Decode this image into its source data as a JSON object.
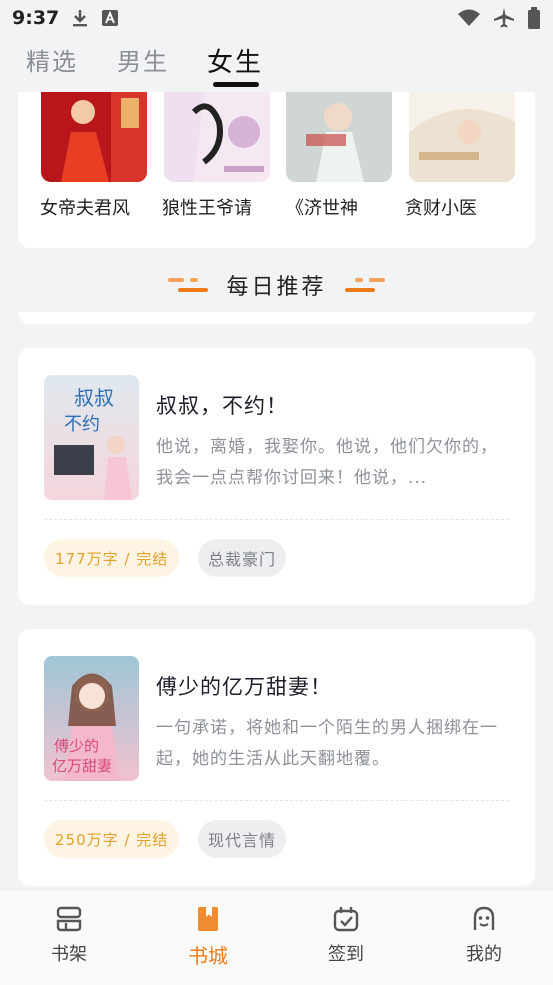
{
  "status": {
    "time": "9:37"
  },
  "tabs": [
    {
      "label": "精选",
      "active": false
    },
    {
      "label": "男生",
      "active": false
    },
    {
      "label": "女生",
      "active": true
    }
  ],
  "featured": [
    {
      "title": "女帝夫君风",
      "cover_colors": [
        "#b8161a",
        "#e24b2e"
      ]
    },
    {
      "title": "狼性王爷请",
      "cover_colors": [
        "#f4e9f3",
        "#d7b3d6"
      ]
    },
    {
      "title": "《济世神",
      "cover_colors": [
        "#cfd6d3",
        "#9fb3ad"
      ]
    },
    {
      "title": "贪财小医",
      "cover_colors": [
        "#f6f1ea",
        "#e6d9c6"
      ]
    }
  ],
  "section": {
    "title": "每日推荐"
  },
  "books": [
    {
      "title": "叔叔，不约！",
      "description": "他说，离婚，我娶你。他说，他们欠你的，我会一点点帮你讨回来！他说，...",
      "info": "177万字 / 完结",
      "category": "总裁豪门",
      "cover_text": "叔叔不约",
      "cover_colors": [
        "#dfe9ee",
        "#f5d6dc"
      ]
    },
    {
      "title": "傅少的亿万甜妻！",
      "description": "一句承诺，将她和一个陌生的男人捆绑在一起，她的生活从此天翻地覆。",
      "info": "250万字 / 完结",
      "category": "现代言情",
      "cover_text": "傅少的亿万甜妻",
      "cover_colors": [
        "#9fc6d6",
        "#f1c2cf"
      ]
    }
  ],
  "nav": [
    {
      "label": "书架",
      "icon": "bookshelf-icon",
      "active": false
    },
    {
      "label": "书城",
      "icon": "bookstore-icon",
      "active": true
    },
    {
      "label": "签到",
      "icon": "checkin-icon",
      "active": false
    },
    {
      "label": "我的",
      "icon": "profile-icon",
      "active": false
    }
  ],
  "colors": {
    "accent": "#ef7a1a",
    "tag_bg": "#fdf4e3",
    "tag_text": "#e3a22a"
  }
}
